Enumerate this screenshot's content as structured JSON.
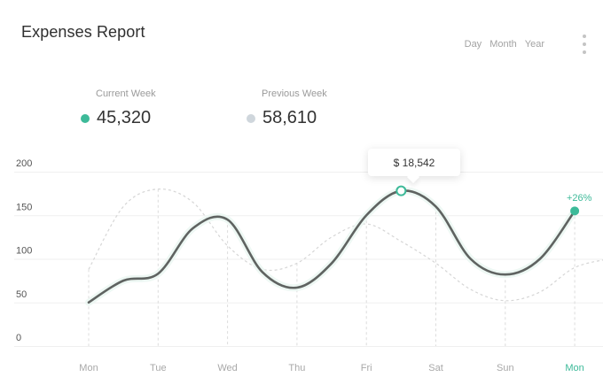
{
  "header": {
    "title": "Expenses Report"
  },
  "range_options": [
    "Day",
    "Month",
    "Year"
  ],
  "stats": {
    "current": {
      "label": "Current Week",
      "value": "45,320",
      "color": "#3dba99"
    },
    "previous": {
      "label": "Previous Week",
      "value": "58,610",
      "color": "#cfd6dc"
    }
  },
  "tooltip": {
    "text": "$ 18,542"
  },
  "change_label": "+26%",
  "colors": {
    "accent": "#3dba99",
    "line": "#5f6361",
    "previous": "#d6d6d6",
    "grid": "#efefef",
    "axis_text": "#555555",
    "day_text": "#a8a8a8"
  },
  "chart_data": {
    "type": "line",
    "categories": [
      "Mon",
      "Tue",
      "Wed",
      "Thu",
      "Fri",
      "Sat",
      "Sun",
      "Mon"
    ],
    "ylim": [
      0,
      200
    ],
    "yticks": [
      0,
      50,
      100,
      150,
      200
    ],
    "highlight_category_index": 7,
    "series": [
      {
        "key": "current",
        "x": [
          0,
          0.5,
          1,
          1.5,
          2,
          2.5,
          3,
          3.5,
          4,
          4.5,
          5,
          5.5,
          6,
          6.5,
          7
        ],
        "y": [
          50,
          75,
          83,
          135,
          145,
          85,
          67,
          95,
          150,
          178,
          160,
          100,
          82,
          100,
          155
        ]
      },
      {
        "key": "previous",
        "x": [
          0,
          0.5,
          1,
          1.5,
          2,
          2.5,
          3,
          3.5,
          4,
          4.5,
          5,
          5.5,
          6,
          6.5,
          7,
          7.5
        ],
        "y": [
          88,
          160,
          180,
          165,
          115,
          88,
          95,
          125,
          140,
          120,
          95,
          65,
          52,
          62,
          90,
          100
        ]
      }
    ],
    "highlight_point": {
      "series": "current",
      "x": 4.5,
      "y": 178
    }
  }
}
